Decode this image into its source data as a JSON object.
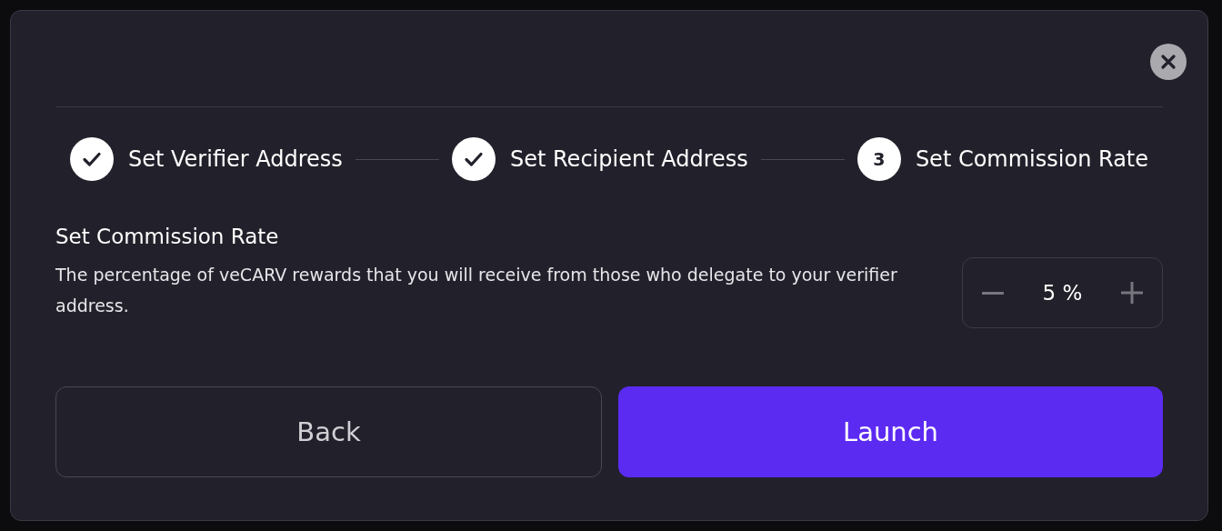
{
  "steps": [
    {
      "label": "Set Verifier Address",
      "completed": true
    },
    {
      "label": "Set Recipient Address",
      "completed": true
    },
    {
      "label": "Set Commission Rate",
      "completed": false,
      "number": "3"
    }
  ],
  "section": {
    "title": "Set Commission Rate",
    "description": "The percentage of veCARV rewards that you will receive from those who delegate to your verifier address."
  },
  "rate": {
    "value": "5",
    "unit": "%"
  },
  "buttons": [
    {
      "label": "Back",
      "kind": "secondary"
    },
    {
      "label": "Launch",
      "kind": "primary"
    }
  ]
}
